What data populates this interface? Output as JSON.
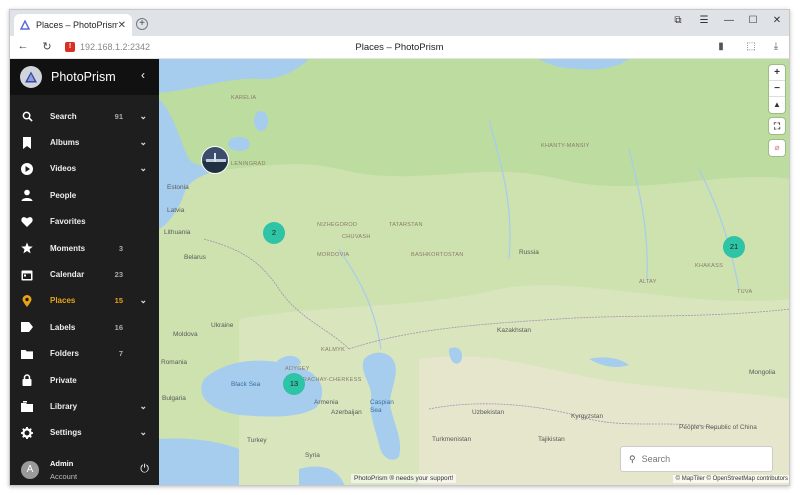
{
  "browser": {
    "tab_title": "Places – PhotoPrism",
    "tab_close": "✕",
    "new_tab": "+",
    "url": "192.168.1.2:2342",
    "page_title": "Places – PhotoPrism",
    "security_warning": "!"
  },
  "sidebar": {
    "brand": "PhotoPrism",
    "items": [
      {
        "label": "Search",
        "count": "91",
        "chevron": true,
        "icon": "search-icon"
      },
      {
        "label": "Albums",
        "count": "",
        "chevron": true,
        "icon": "bookmark-icon"
      },
      {
        "label": "Videos",
        "count": "",
        "chevron": true,
        "icon": "play-icon"
      },
      {
        "label": "People",
        "count": "",
        "chevron": false,
        "icon": "person-icon"
      },
      {
        "label": "Favorites",
        "count": "",
        "chevron": false,
        "icon": "heart-icon"
      },
      {
        "label": "Moments",
        "count": "3",
        "chevron": false,
        "icon": "star-icon"
      },
      {
        "label": "Calendar",
        "count": "23",
        "chevron": false,
        "icon": "calendar-icon"
      },
      {
        "label": "Places",
        "count": "15",
        "chevron": true,
        "icon": "place-icon",
        "active": true
      },
      {
        "label": "Labels",
        "count": "16",
        "chevron": false,
        "icon": "label-icon"
      },
      {
        "label": "Folders",
        "count": "7",
        "chevron": false,
        "icon": "folder-icon"
      },
      {
        "label": "Private",
        "count": "",
        "chevron": false,
        "icon": "lock-icon"
      },
      {
        "label": "Library",
        "count": "",
        "chevron": true,
        "icon": "library-icon"
      },
      {
        "label": "Settings",
        "count": "",
        "chevron": true,
        "icon": "gear-icon"
      }
    ],
    "user": {
      "initial": "A",
      "name": "Admin",
      "role": "Account"
    }
  },
  "map": {
    "clusters": [
      "2",
      "21",
      "13"
    ],
    "search_placeholder": "Search",
    "support_text": "PhotoPrism ® needs your support!",
    "attribution": "© MapTiler © OpenStreetMap contributors",
    "zoom_in": "+",
    "zoom_out": "−",
    "labels": {
      "karelia": "KARELIA",
      "leningrad": "LENINGRAD",
      "estonia": "Estonia",
      "latvia": "Latvia",
      "lithuania": "Lithuania",
      "nizhegorod": "NIZHEGOROD",
      "chuvash": "CHUVASH",
      "tatarstan": "TATARSTAN",
      "mordovia": "MORDOVIA",
      "bashkortostan": "BASHKORTOSTAN",
      "khanty": "KHANTY-MANSIY",
      "russia": "Russia",
      "belarus": "Belarus",
      "ukraine": "Ukraine",
      "moldova": "Moldova",
      "romania": "Romania",
      "bulgaria": "Bulgaria",
      "turkey": "Turkey",
      "syria": "Syria",
      "kazakhstan": "Kazakhstan",
      "uzbekistan": "Uzbekistan",
      "turkmenistan": "Turkmenistan",
      "kyrgyzstan": "Kyrgyzstan",
      "tajikistan": "Tajikistan",
      "china": "People's Republic of China",
      "mongolia": "Mongolia",
      "black_sea": "Black Sea",
      "caspian": "Caspian Sea",
      "kalmyk": "KALMYK",
      "adygey": "ADYGEY",
      "karachay": "KARACHAY-CHERKESS",
      "altay": "ALTAY",
      "khakass": "KHAKASS",
      "tuva": "TUVA",
      "armenia": "Armenia",
      "azerbaijan": "Azerbaijan"
    }
  }
}
